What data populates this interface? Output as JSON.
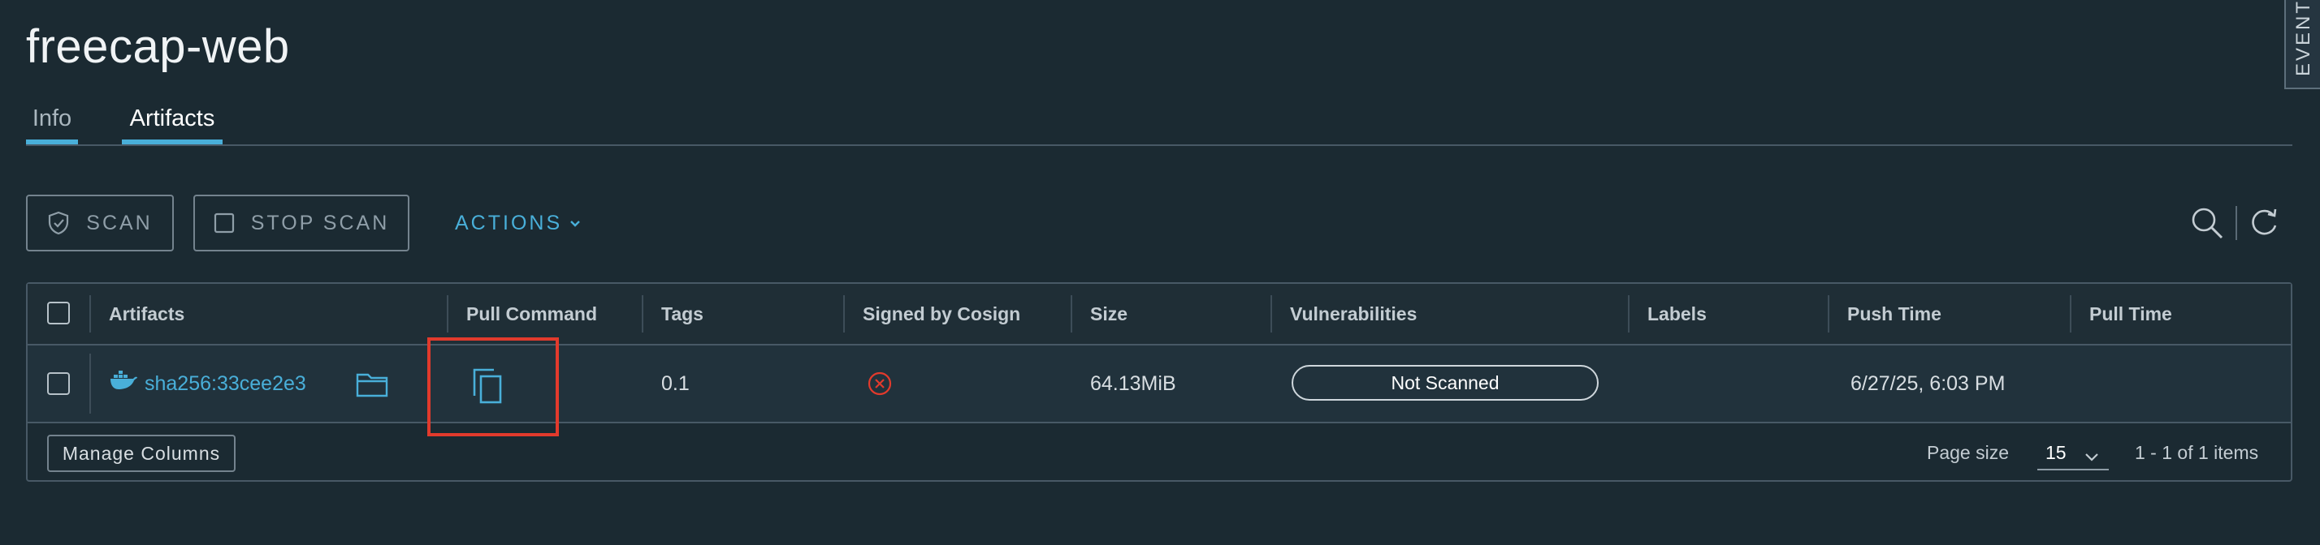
{
  "page": {
    "title": "freecap-web"
  },
  "tabs": [
    {
      "label": "Info"
    },
    {
      "label": "Artifacts"
    }
  ],
  "side_tab": {
    "label": "EVENTS"
  },
  "toolbar": {
    "scan_label": "SCAN",
    "stop_scan_label": "STOP SCAN",
    "actions_label": "ACTIONS"
  },
  "grid": {
    "columns": [
      "Artifacts",
      "Pull Command",
      "Tags",
      "Signed by Cosign",
      "Size",
      "Vulnerabilities",
      "Labels",
      "Push Time",
      "Pull Time"
    ],
    "rows": [
      {
        "artifact": "sha256:33cee2e3",
        "tags": "0.1",
        "signed": "not-signed",
        "size": "64.13MiB",
        "vulnerabilities": "Not Scanned",
        "labels": "",
        "push_time": "6/27/25, 6:03 PM",
        "pull_time": ""
      }
    ],
    "footer": {
      "manage_columns_label": "Manage Columns",
      "page_size_label": "Page size",
      "page_size_value": "15",
      "items_count": "1 - 1 of 1 items"
    }
  },
  "colors": {
    "background": "#1b2a32",
    "accent": "#49afd9",
    "highlight": "#e23a2c",
    "error": "#e23a2c"
  },
  "icons": {
    "scan": "shield-check-icon",
    "stop_scan": "square-icon",
    "actions_caret": "chevron-down-icon",
    "search": "search-icon",
    "refresh": "refresh-icon",
    "artifact_type": "docker-icon",
    "folder": "folder-icon",
    "copy": "copy-icon",
    "signed": "times-circle-icon"
  }
}
